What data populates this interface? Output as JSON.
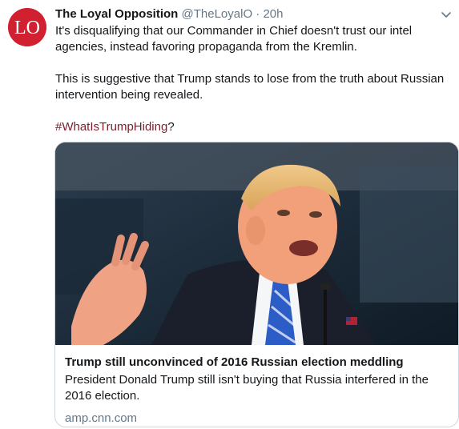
{
  "tweet": {
    "author_name": "The Loyal Opposition",
    "handle": "@TheLoyalO",
    "separator": "·",
    "time": "20h",
    "paragraph_1": "It's disqualifying that our Commander in Chief doesn't trust our intel agencies, instead favoring propaganda from the Kremlin.",
    "paragraph_2": "This is suggestive that Trump stands to lose from the truth about Russian intervention being revealed.",
    "hashtag": "#WhatIsTrumpHiding",
    "hashtag_suffix": "?",
    "avatar_text": "LO",
    "caret_icon": "chevron-down-icon"
  },
  "card": {
    "title": "Trump still unconvinced of 2016 Russian election meddling",
    "description": "President Donald Trump still isn't buying that Russia interfered in the 2016 election.",
    "domain": "amp.cnn.com"
  },
  "colors": {
    "avatar_bg": "#d1202f",
    "hashtag": "#7a1f2b",
    "muted": "#657786",
    "border": "#ccd6dd"
  }
}
